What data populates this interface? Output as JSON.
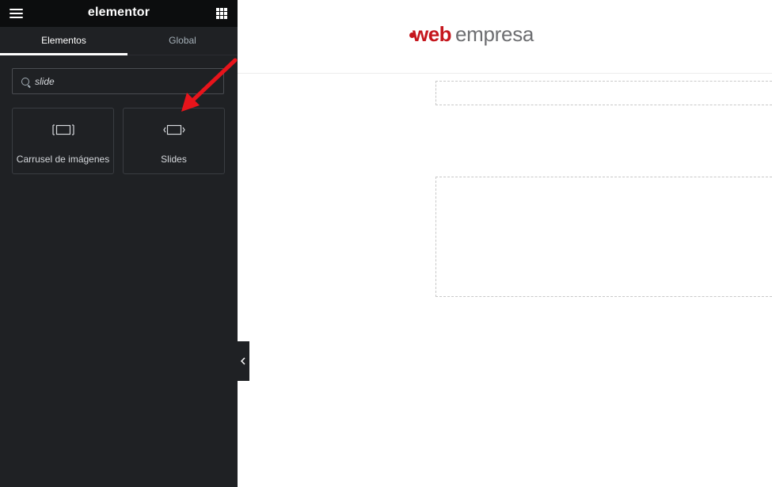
{
  "panel": {
    "brand": "elementor",
    "menu_icon": "hamburger-menu-icon",
    "grid_icon": "apps-grid-icon",
    "tabs": [
      {
        "label": "Elementos",
        "active": true
      },
      {
        "label": "Global",
        "active": false
      }
    ],
    "search": {
      "value": "slide",
      "icon": "search-icon"
    },
    "widgets": [
      {
        "label": "Carrusel de imágenes",
        "icon": "image-carousel-icon"
      },
      {
        "label": "Slides",
        "icon": "slides-icon"
      }
    ]
  },
  "preview": {
    "logo": {
      "part1": "web",
      "part2": "empresa",
      "accent_color": "#c5161d",
      "text_color": "#6d6e71"
    }
  },
  "annotation": {
    "arrow_color": "#e8141b"
  },
  "colors": {
    "panel_bg": "#1f2124",
    "header_bg": "#0c0d0e"
  }
}
